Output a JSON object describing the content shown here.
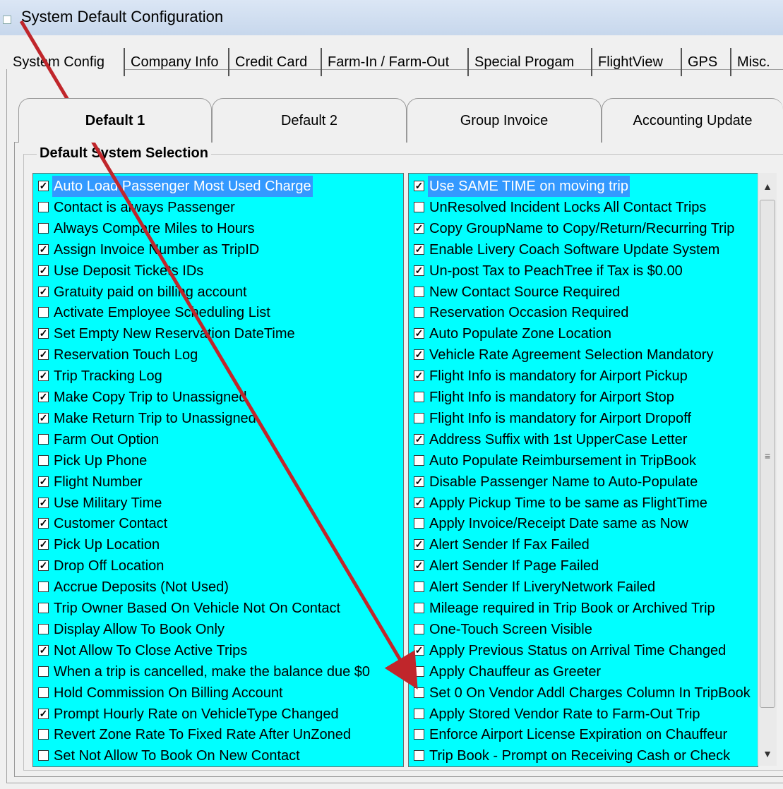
{
  "window": {
    "title": "System Default Configuration"
  },
  "outer_tabs": [
    "System Config",
    "Company Info",
    "Credit Card",
    "Farm-In / Farm-Out",
    "Special Progam",
    "FlightView",
    "GPS",
    "Misc."
  ],
  "inner_tabs": [
    "Default 1",
    "Default 2",
    "Group Invoice",
    "Accounting Update"
  ],
  "group_title": "Default System Selection",
  "left_list": [
    {
      "label": "Auto Load Passenger Most Used Charge",
      "checked": true,
      "selected": true
    },
    {
      "label": "Contact is always Passenger",
      "checked": false
    },
    {
      "label": "Always Compare Miles to Hours",
      "checked": false
    },
    {
      "label": "Assign Invoice Number as TripID",
      "checked": true
    },
    {
      "label": "Use Deposit Tickets IDs",
      "checked": true
    },
    {
      "label": "Gratuity paid on billing account",
      "checked": true
    },
    {
      "label": "Activate Employee Scheduling List",
      "checked": false
    },
    {
      "label": "Set Empty New Reservation DateTime",
      "checked": true
    },
    {
      "label": "Reservation Touch Log",
      "checked": true
    },
    {
      "label": "Trip Tracking Log",
      "checked": true
    },
    {
      "label": "Make Copy Trip to Unassigned",
      "checked": true
    },
    {
      "label": "Make Return Trip to Unassigned",
      "checked": true
    },
    {
      "label": "Farm Out Option",
      "checked": false
    },
    {
      "label": "Pick Up Phone",
      "checked": false
    },
    {
      "label": "Flight Number",
      "checked": true
    },
    {
      "label": "Use Military Time",
      "checked": true
    },
    {
      "label": "Customer Contact",
      "checked": true
    },
    {
      "label": "Pick Up Location",
      "checked": true
    },
    {
      "label": "Drop Off Location",
      "checked": true
    },
    {
      "label": "Accrue Deposits (Not Used)",
      "checked": false
    },
    {
      "label": "Trip Owner Based On Vehicle Not On Contact",
      "checked": false
    },
    {
      "label": "Display Allow To Book Only",
      "checked": false
    },
    {
      "label": "Not Allow To Close Active Trips",
      "checked": true
    },
    {
      "label": "When a trip is cancelled, make the balance due $0",
      "checked": false
    },
    {
      "label": "Hold Commission On Billing Account",
      "checked": false
    },
    {
      "label": "Prompt Hourly Rate on VehicleType Changed",
      "checked": true
    },
    {
      "label": "Revert Zone Rate To Fixed Rate After UnZoned",
      "checked": false
    },
    {
      "label": "Set Not Allow To Book On New Contact",
      "checked": false
    }
  ],
  "right_list": [
    {
      "label": "Use SAME TIME on moving trip",
      "checked": true,
      "selected": true
    },
    {
      "label": "UnResolved Incident Locks All Contact Trips",
      "checked": false
    },
    {
      "label": "Copy GroupName to Copy/Return/Recurring Trip",
      "checked": true
    },
    {
      "label": "Enable Livery Coach Software Update System",
      "checked": true
    },
    {
      "label": "Un-post Tax to PeachTree if Tax is $0.00",
      "checked": true
    },
    {
      "label": "New Contact Source Required",
      "checked": false
    },
    {
      "label": "Reservation Occasion Required",
      "checked": false
    },
    {
      "label": "Auto Populate Zone Location",
      "checked": true
    },
    {
      "label": "Vehicle Rate Agreement Selection Mandatory",
      "checked": true
    },
    {
      "label": "Flight Info is mandatory for Airport Pickup",
      "checked": true
    },
    {
      "label": "Flight Info is mandatory for Airport Stop",
      "checked": false
    },
    {
      "label": "Flight Info is mandatory for Airport Dropoff",
      "checked": false
    },
    {
      "label": "Address Suffix with 1st UpperCase Letter",
      "checked": true
    },
    {
      "label": "Auto Populate Reimbursement in TripBook",
      "checked": false
    },
    {
      "label": "Disable Passenger Name to Auto-Populate",
      "checked": true
    },
    {
      "label": "Apply Pickup Time to be same as FlightTime",
      "checked": true
    },
    {
      "label": "Apply Invoice/Receipt Date same as Now",
      "checked": false
    },
    {
      "label": "Alert Sender If Fax Failed",
      "checked": true
    },
    {
      "label": "Alert Sender If Page Failed",
      "checked": true
    },
    {
      "label": "Alert Sender If LiveryNetwork Failed",
      "checked": false
    },
    {
      "label": "Mileage required in Trip Book or Archived Trip",
      "checked": false
    },
    {
      "label": "One-Touch Screen Visible",
      "checked": false
    },
    {
      "label": "Apply Previous Status on Arrival Time Changed",
      "checked": true
    },
    {
      "label": "Apply Chauffeur as Greeter",
      "checked": false
    },
    {
      "label": "Set 0 On Vendor Addl Charges Column In TripBook",
      "checked": false
    },
    {
      "label": "Apply Stored Vendor Rate to Farm-Out Trip",
      "checked": false
    },
    {
      "label": "Enforce Airport License Expiration on Chauffeur",
      "checked": false
    },
    {
      "label": "Trip Book - Prompt on Receiving Cash or Check",
      "checked": false
    }
  ],
  "annotation": {
    "arrow_color": "#c0262b"
  }
}
